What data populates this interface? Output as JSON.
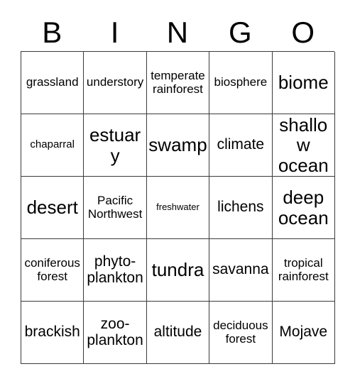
{
  "card": {
    "header_letters": [
      "B",
      "I",
      "N",
      "G",
      "O"
    ],
    "columns": 5,
    "rows": 5,
    "border_color": "#3a3a3a",
    "background_color": "#ffffff",
    "text_color": "#000000",
    "cells": [
      [
        {
          "text": "grassland",
          "size": "fs-m"
        },
        {
          "text": "understory",
          "size": "fs-m"
        },
        {
          "text": "temperate rainforest",
          "size": "fs-m"
        },
        {
          "text": "biosphere",
          "size": "fs-m"
        },
        {
          "text": "biome",
          "size": "fs-xl"
        }
      ],
      [
        {
          "text": "chaparral",
          "size": "fs-s"
        },
        {
          "text": "estuary",
          "size": "fs-xl"
        },
        {
          "text": "swamp",
          "size": "fs-xl"
        },
        {
          "text": "climate",
          "size": "fs-l"
        },
        {
          "text": "shallow ocean",
          "size": "fs-xl"
        }
      ],
      [
        {
          "text": "desert",
          "size": "fs-xl"
        },
        {
          "text": "Pacific Northwest",
          "size": "fs-m"
        },
        {
          "text": "freshwater",
          "size": "fs-xs"
        },
        {
          "text": "lichens",
          "size": "fs-l"
        },
        {
          "text": "deep ocean",
          "size": "fs-xl"
        }
      ],
      [
        {
          "text": "coniferous forest",
          "size": "fs-m"
        },
        {
          "text": "phyto-plankton",
          "size": "fs-l"
        },
        {
          "text": "tundra",
          "size": "fs-xl"
        },
        {
          "text": "savanna",
          "size": "fs-l"
        },
        {
          "text": "tropical rainforest",
          "size": "fs-m"
        }
      ],
      [
        {
          "text": "brackish",
          "size": "fs-l"
        },
        {
          "text": "zoo-plankton",
          "size": "fs-l"
        },
        {
          "text": "altitude",
          "size": "fs-l"
        },
        {
          "text": "deciduous forest",
          "size": "fs-m"
        },
        {
          "text": "Mojave",
          "size": "fs-l"
        }
      ]
    ]
  }
}
